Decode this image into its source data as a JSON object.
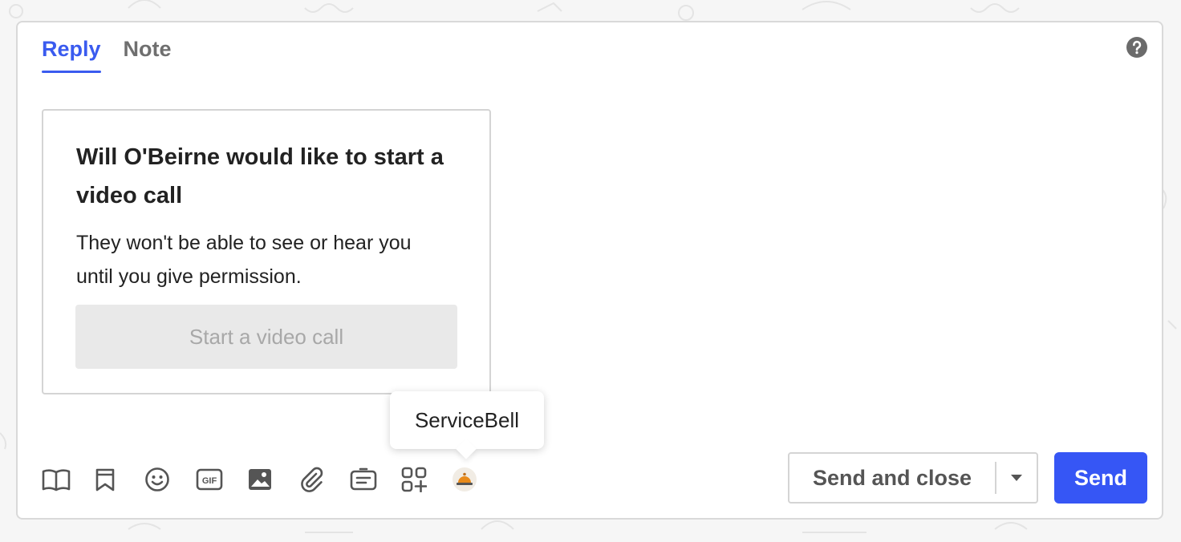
{
  "tabs": [
    {
      "label": "Reply",
      "active": true
    },
    {
      "label": "Note",
      "active": false
    }
  ],
  "help_icon": "question-circle-icon",
  "video_card": {
    "title": "Will O'Beirne would like to start a video call",
    "body": "They won't be able to see or hear you until you give permission.",
    "button_label": "Start a video call"
  },
  "tooltip": {
    "text": "ServiceBell"
  },
  "toolbar": {
    "icons": [
      "book-icon",
      "bookmark-icon",
      "emoji-icon",
      "gif-icon",
      "image-icon",
      "attachment-icon",
      "article-icon",
      "apps-icon",
      "servicebell-icon"
    ],
    "gif_text": "GIF"
  },
  "actions": {
    "send_and_close_label": "Send and close",
    "send_label": "Send"
  },
  "colors": {
    "accent": "#3656f5",
    "tab_active": "#3a5bef",
    "border": "#d9d9d9"
  }
}
